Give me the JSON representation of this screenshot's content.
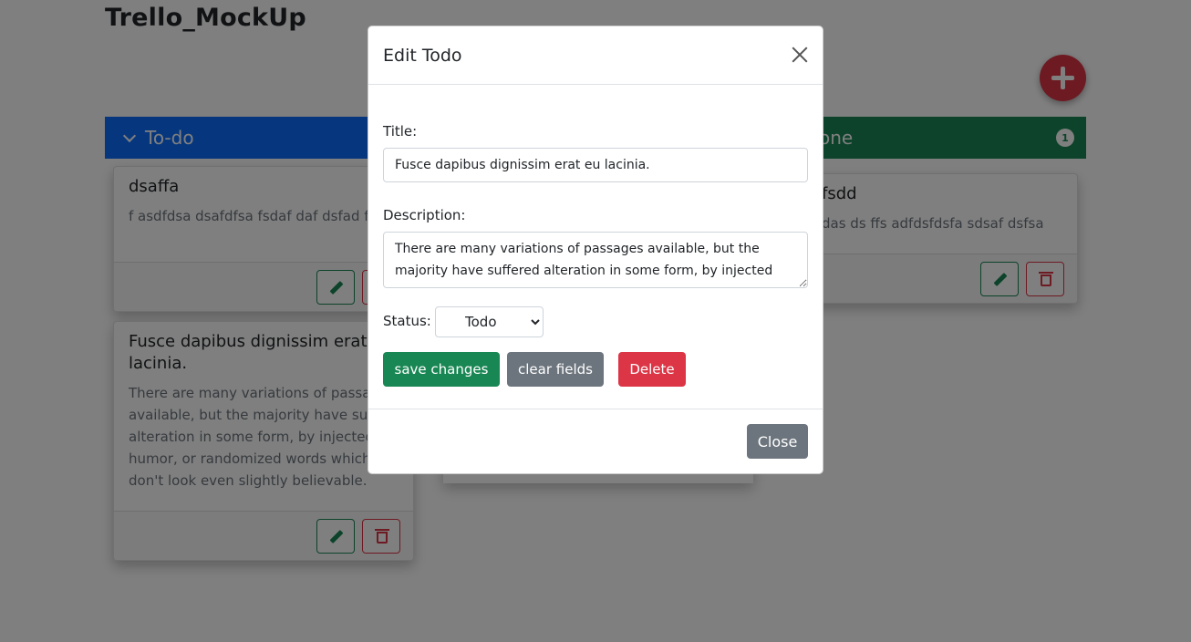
{
  "app": {
    "title": "Trello_MockUp"
  },
  "columns": [
    {
      "label": "To-do",
      "color": "#0d6efd"
    },
    {
      "label": "one",
      "color": "#198754",
      "count": "1"
    }
  ],
  "cards": [
    {
      "title": "dsaffa",
      "text": "f asdfdsa dsafdfsa fsdaf daf dsfad fadsf"
    },
    {
      "title": "Fusce dapibus dignissim erat lacinia.",
      "text": "There are many variations of passa available, but the majority have suff alteration in some form, by injected humor, or randomized words which don't look even slightly believable."
    },
    {
      "title": "fsdd",
      "text": "das ds ffs adfdsfdsfa sdsaf dsfsa"
    }
  ],
  "modal": {
    "title": "Edit Todo",
    "title_label": "Title:",
    "title_value": "Fusce dapibus dignissim erat eu lacinia.",
    "description_label": "Description:",
    "description_value": "There are many variations of passages available, but the majority have suffered alteration in some form, by injected",
    "status_label": "Status:",
    "status_value": "Todo",
    "save_label": "save changes",
    "clear_label": "clear fields",
    "delete_label": "Delete",
    "close_label": "Close"
  },
  "colors": {
    "primary": "#0d6efd",
    "success": "#198754",
    "danger": "#dc3545",
    "secondary": "#6c757d"
  }
}
